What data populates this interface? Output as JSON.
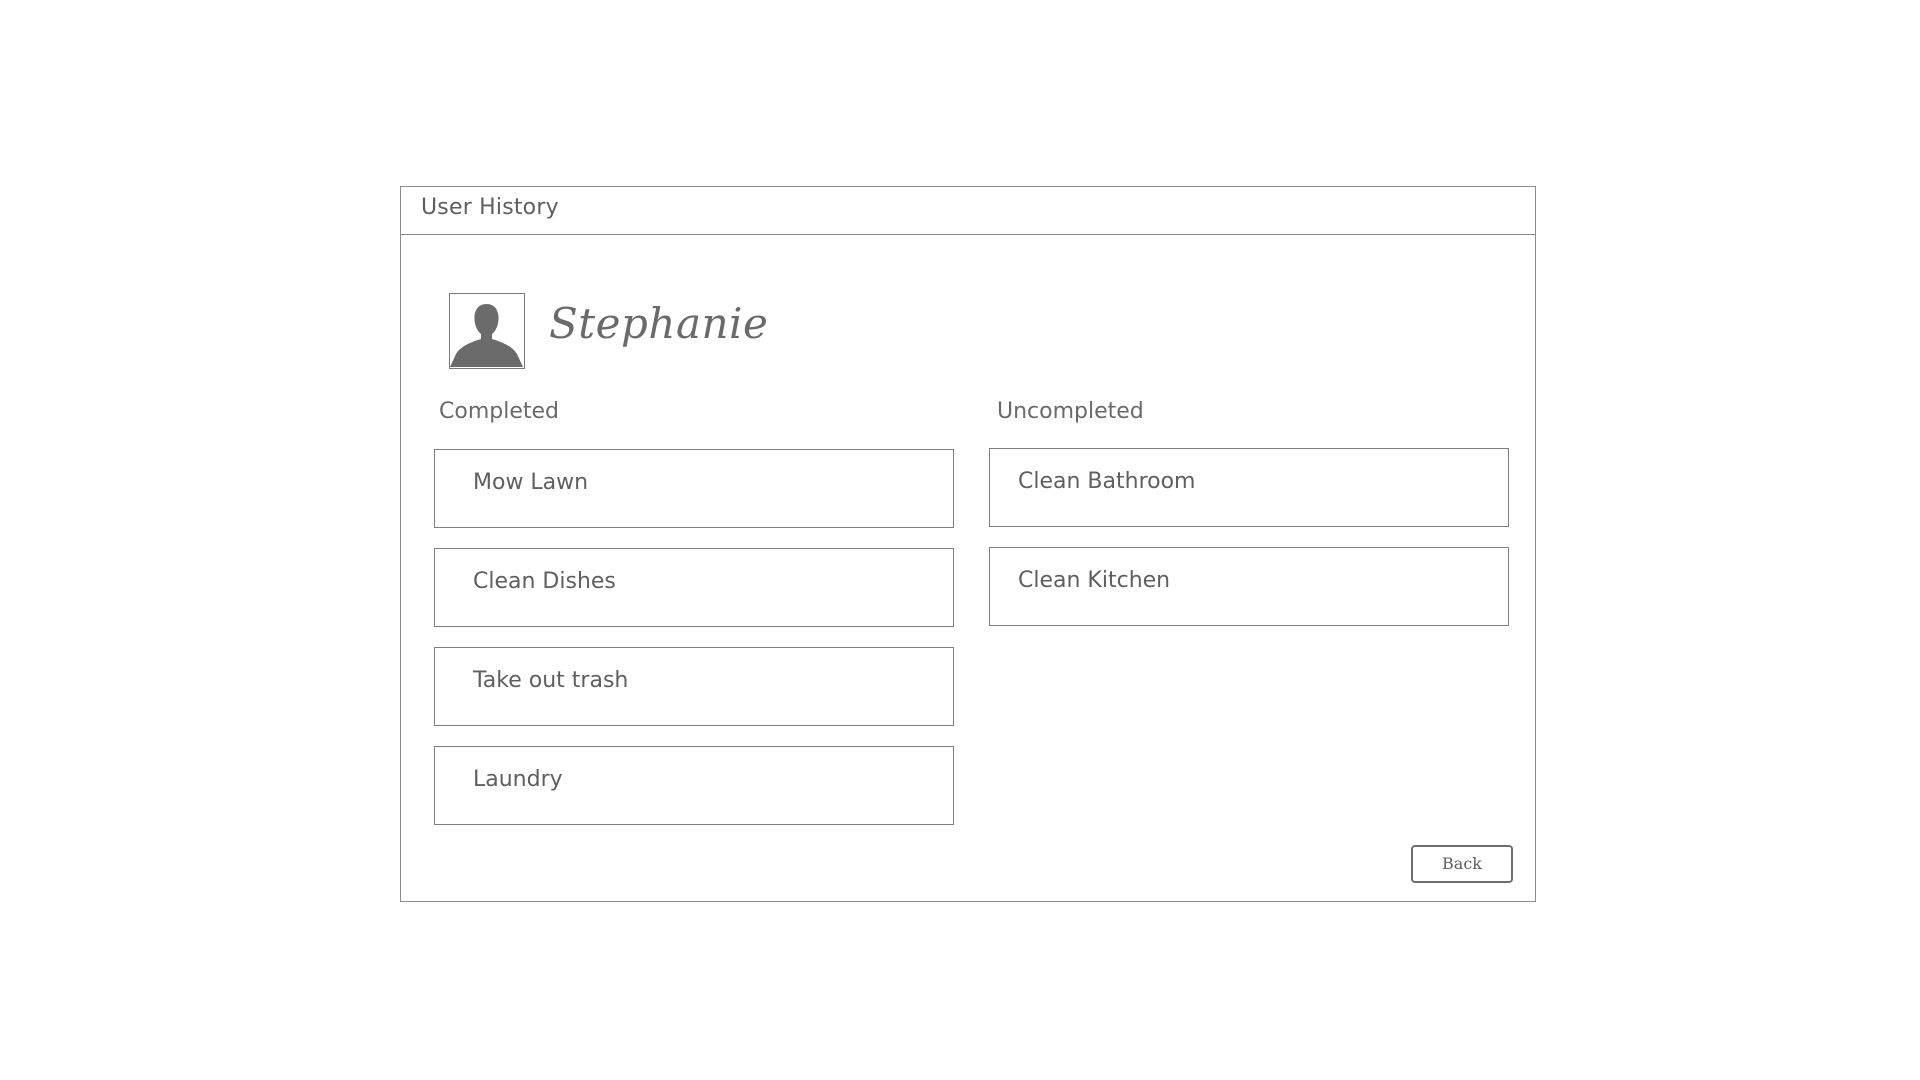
{
  "window": {
    "title": "User History"
  },
  "user": {
    "name": "Stephanie",
    "avatar_icon": "person-silhouette-icon"
  },
  "completed": {
    "heading": "Completed",
    "tasks": [
      {
        "label": "Mow Lawn"
      },
      {
        "label": "Clean Dishes"
      },
      {
        "label": "Take out trash"
      },
      {
        "label": "Laundry"
      }
    ]
  },
  "uncompleted": {
    "heading": "Uncompleted",
    "tasks": [
      {
        "label": "Clean Bathroom"
      },
      {
        "label": "Clean Kitchen"
      }
    ]
  },
  "actions": {
    "back_label": "Back"
  },
  "colors": {
    "border": "#8a8a8a",
    "text": "#5f5f5f",
    "background": "#ffffff"
  }
}
